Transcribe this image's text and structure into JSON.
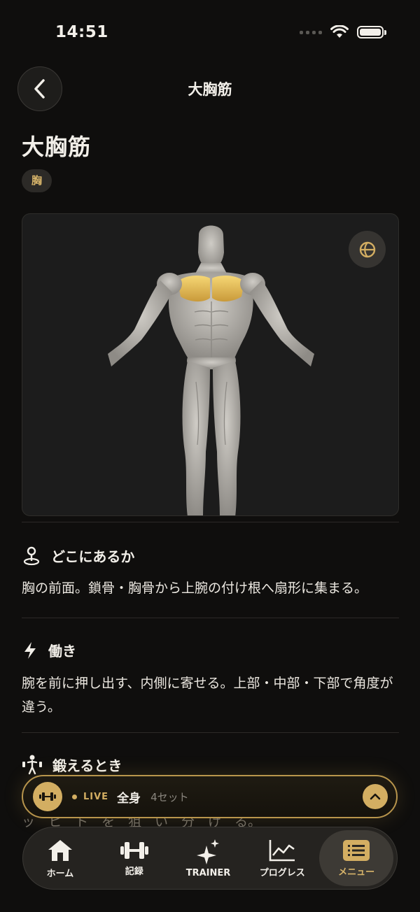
{
  "status": {
    "time": "14:51"
  },
  "nav": {
    "title": "大胸筋"
  },
  "muscle": {
    "name": "大胸筋",
    "category": "胸"
  },
  "sections": [
    {
      "icon": "location-pin-icon",
      "title": "どこにあるか",
      "body": "胸の前面。鎖骨・胸骨から上腕の付け根へ扇形に集まる。"
    },
    {
      "icon": "lightning-icon",
      "title": "働き",
      "body": "腕を前に押し出す、内側に寄せる。上部・中部・下部で角度が違う。"
    },
    {
      "icon": "exercise-person-icon",
      "title": "鍛えるとき",
      "body": ""
    }
  ],
  "peek": {
    "text": "ッ　ヒ　ト　を　狙　い　分　け　る。"
  },
  "live": {
    "label": "LIVE",
    "title": "全身",
    "sets": "4セット"
  },
  "tabs": [
    {
      "icon": "home-icon",
      "label": "ホーム",
      "active": false
    },
    {
      "icon": "dumbbell-icon",
      "label": "記録",
      "active": false
    },
    {
      "icon": "sparkle-icon",
      "label": "TRAINER",
      "active": false
    },
    {
      "icon": "chart-icon",
      "label": "プログレス",
      "active": false
    },
    {
      "icon": "menu-list-icon",
      "label": "メニュー",
      "active": true
    }
  ],
  "colors": {
    "accent": "#d3ae62",
    "background": "#0f0e0d",
    "highlight": "#e8c060"
  }
}
